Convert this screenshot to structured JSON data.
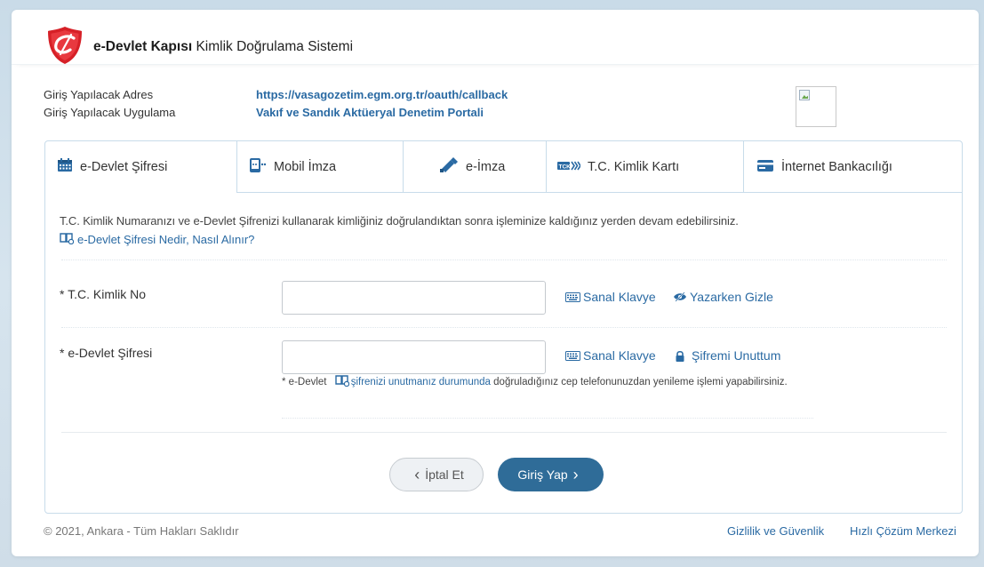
{
  "header": {
    "brand_bold": "e-Devlet Kapısı",
    "brand_rest": " Kimlik Doğrulama Sistemi"
  },
  "info": {
    "address_label": "Giriş Yapılacak Adres",
    "address_value": "https://vasagozetim.egm.org.tr/oauth/callback",
    "app_label": "Giriş Yapılacak Uygulama",
    "app_value": "Vakıf ve Sandık Aktüeryal Denetim Portali"
  },
  "tabs": [
    {
      "label": "e-Devlet Şifresi",
      "icon": "calendar-icon",
      "active": true
    },
    {
      "label": "Mobil İmza",
      "icon": "mobile-signature-icon"
    },
    {
      "label": "e-İmza",
      "icon": "usb-token-icon"
    },
    {
      "label": "T.C. Kimlik Kartı",
      "icon": "id-card-icon"
    },
    {
      "label": "İnternet Bankacılığı",
      "icon": "credit-card-icon"
    }
  ],
  "description": "T.C. Kimlik Numaranızı ve e-Devlet Şifrenizi kullanarak kimliğiniz doğrulandıktan sonra işleminize kaldığınız yerden devam edebilirsiniz.",
  "help_link": "e-Devlet Şifresi Nedir, Nasıl Alınır?",
  "form": {
    "tc_label": "* T.C. Kimlik No",
    "tc_value": "",
    "password_label": "* e-Devlet Şifresi",
    "password_value": "",
    "virtual_keyboard": "Sanal Klavye",
    "hide_typing": "Yazarken Gizle",
    "forgot_password": "Şifremi Unuttum",
    "note_prefix": "* e-Devlet",
    "note_link": "şifrenizi unutmanız durumunda",
    "note_suffix": " doğruladığınız cep telefonunuzdan yenileme işlemi yapabilirsiniz."
  },
  "buttons": {
    "cancel": "İptal Et",
    "login": "Giriş Yap"
  },
  "footer": {
    "copyright": "© 2021, Ankara - Tüm Hakları Saklıdır",
    "privacy": "Gizlilik ve Güvenlik",
    "help_center": "Hızlı Çözüm Merkezi"
  },
  "colors": {
    "link": "#2a6aa3",
    "primary_button": "#2f6c98",
    "logo_red": "#d62027",
    "panel_border": "#c8dcea"
  }
}
